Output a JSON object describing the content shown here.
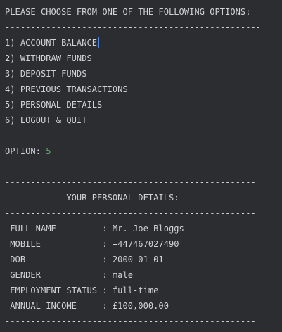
{
  "menu": {
    "prompt": "PLEASE CHOOSE FROM ONE OF THE FOLLOWING OPTIONS:",
    "divider": "--------------------------------------------------",
    "options": [
      "1) ACCOUNT BALANCE",
      "2) WITHDRAW FUNDS",
      "3) DEPOSIT FUNDS",
      "4) PREVIOUS TRANSACTIONS",
      "5) PERSONAL DETAILS",
      "6) LOGOUT & QUIT"
    ]
  },
  "selection": {
    "label": "OPTION: ",
    "value": "5"
  },
  "details": {
    "divider": "-------------------------------------------------",
    "title": "            YOUR PERSONAL DETAILS:",
    "rows": [
      {
        "label": " FULL NAME         : ",
        "value": "Mr. Joe Bloggs"
      },
      {
        "label": " MOBILE            : ",
        "value": "+447467027490"
      },
      {
        "label": " DOB               : ",
        "value": "2000-01-01"
      },
      {
        "label": " GENDER            : ",
        "value": "male"
      },
      {
        "label": " EMPLOYMENT STATUS : ",
        "value": "full-time"
      },
      {
        "label": " ANNUAL INCOME     : ",
        "value": "£100,000.00"
      }
    ]
  },
  "colors": {
    "background": "#2b2d30",
    "text": "#cfd2d6",
    "input": "#6aab73",
    "cursor": "#4a88e8"
  }
}
